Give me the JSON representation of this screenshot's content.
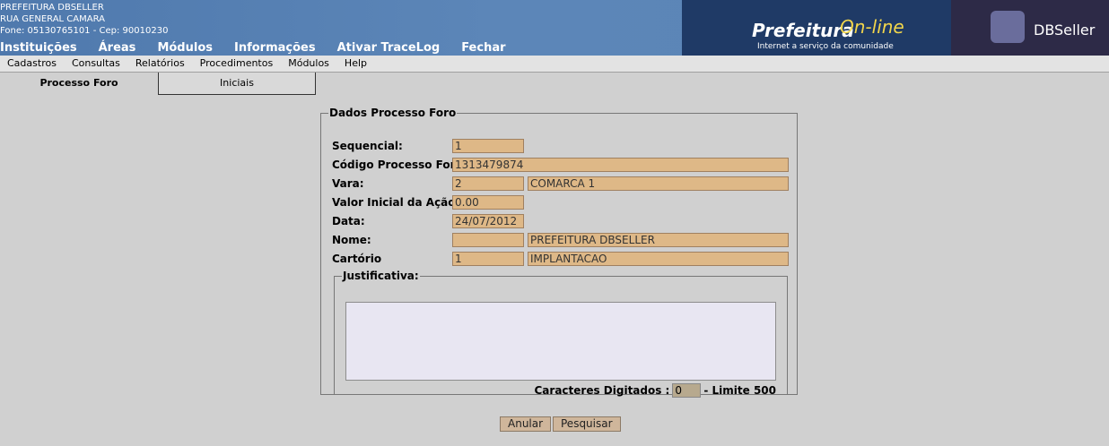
{
  "header": {
    "org_name": "PREFEITURA DBSELLER",
    "address": "RUA GENERAL CAMARA",
    "phone_line": "Fone: 05130765101  -  Cep: 90010230",
    "brand_prefeitura": "Prefeitura",
    "brand_online": "On-line",
    "brand_tagline": "Internet a serviço da comunidade",
    "brand_company": "DBSeller"
  },
  "main_menu": [
    "Instituições",
    "Áreas",
    "Módulos",
    "Informações",
    "Ativar TraceLog",
    "Fechar"
  ],
  "sub_menu": [
    "Cadastros",
    "Consultas",
    "Relatórios",
    "Procedimentos",
    "Módulos",
    "Help"
  ],
  "tabs": {
    "active": "Processo Foro",
    "inactive": "Iniciais"
  },
  "form": {
    "legend": "Dados Processo Foro",
    "sequencial_label": "Sequencial:",
    "sequencial_value": "1",
    "codigo_label": "Código Processo Foro:",
    "codigo_value": "1313479874",
    "vara_label": "Vara:",
    "vara_code": "2",
    "vara_name": "COMARCA 1",
    "valor_label": "Valor Inicial da Ação:",
    "valor_value": "0.00",
    "data_label": "Data:",
    "data_value": "24/07/2012",
    "nome_label": "Nome:",
    "nome_code": "",
    "nome_value": "PREFEITURA DBSELLER",
    "cartorio_label": "Cartório",
    "cartorio_code": "1",
    "cartorio_name": "IMPLANTACAO",
    "justificativa_legend": "Justificativa:",
    "justificativa_text": "",
    "chars_label": "Caracteres Digitados :",
    "chars_count": "0",
    "chars_limit": "- Limite 500"
  },
  "buttons": {
    "anular": "Anular",
    "pesquisar": "Pesquisar"
  }
}
